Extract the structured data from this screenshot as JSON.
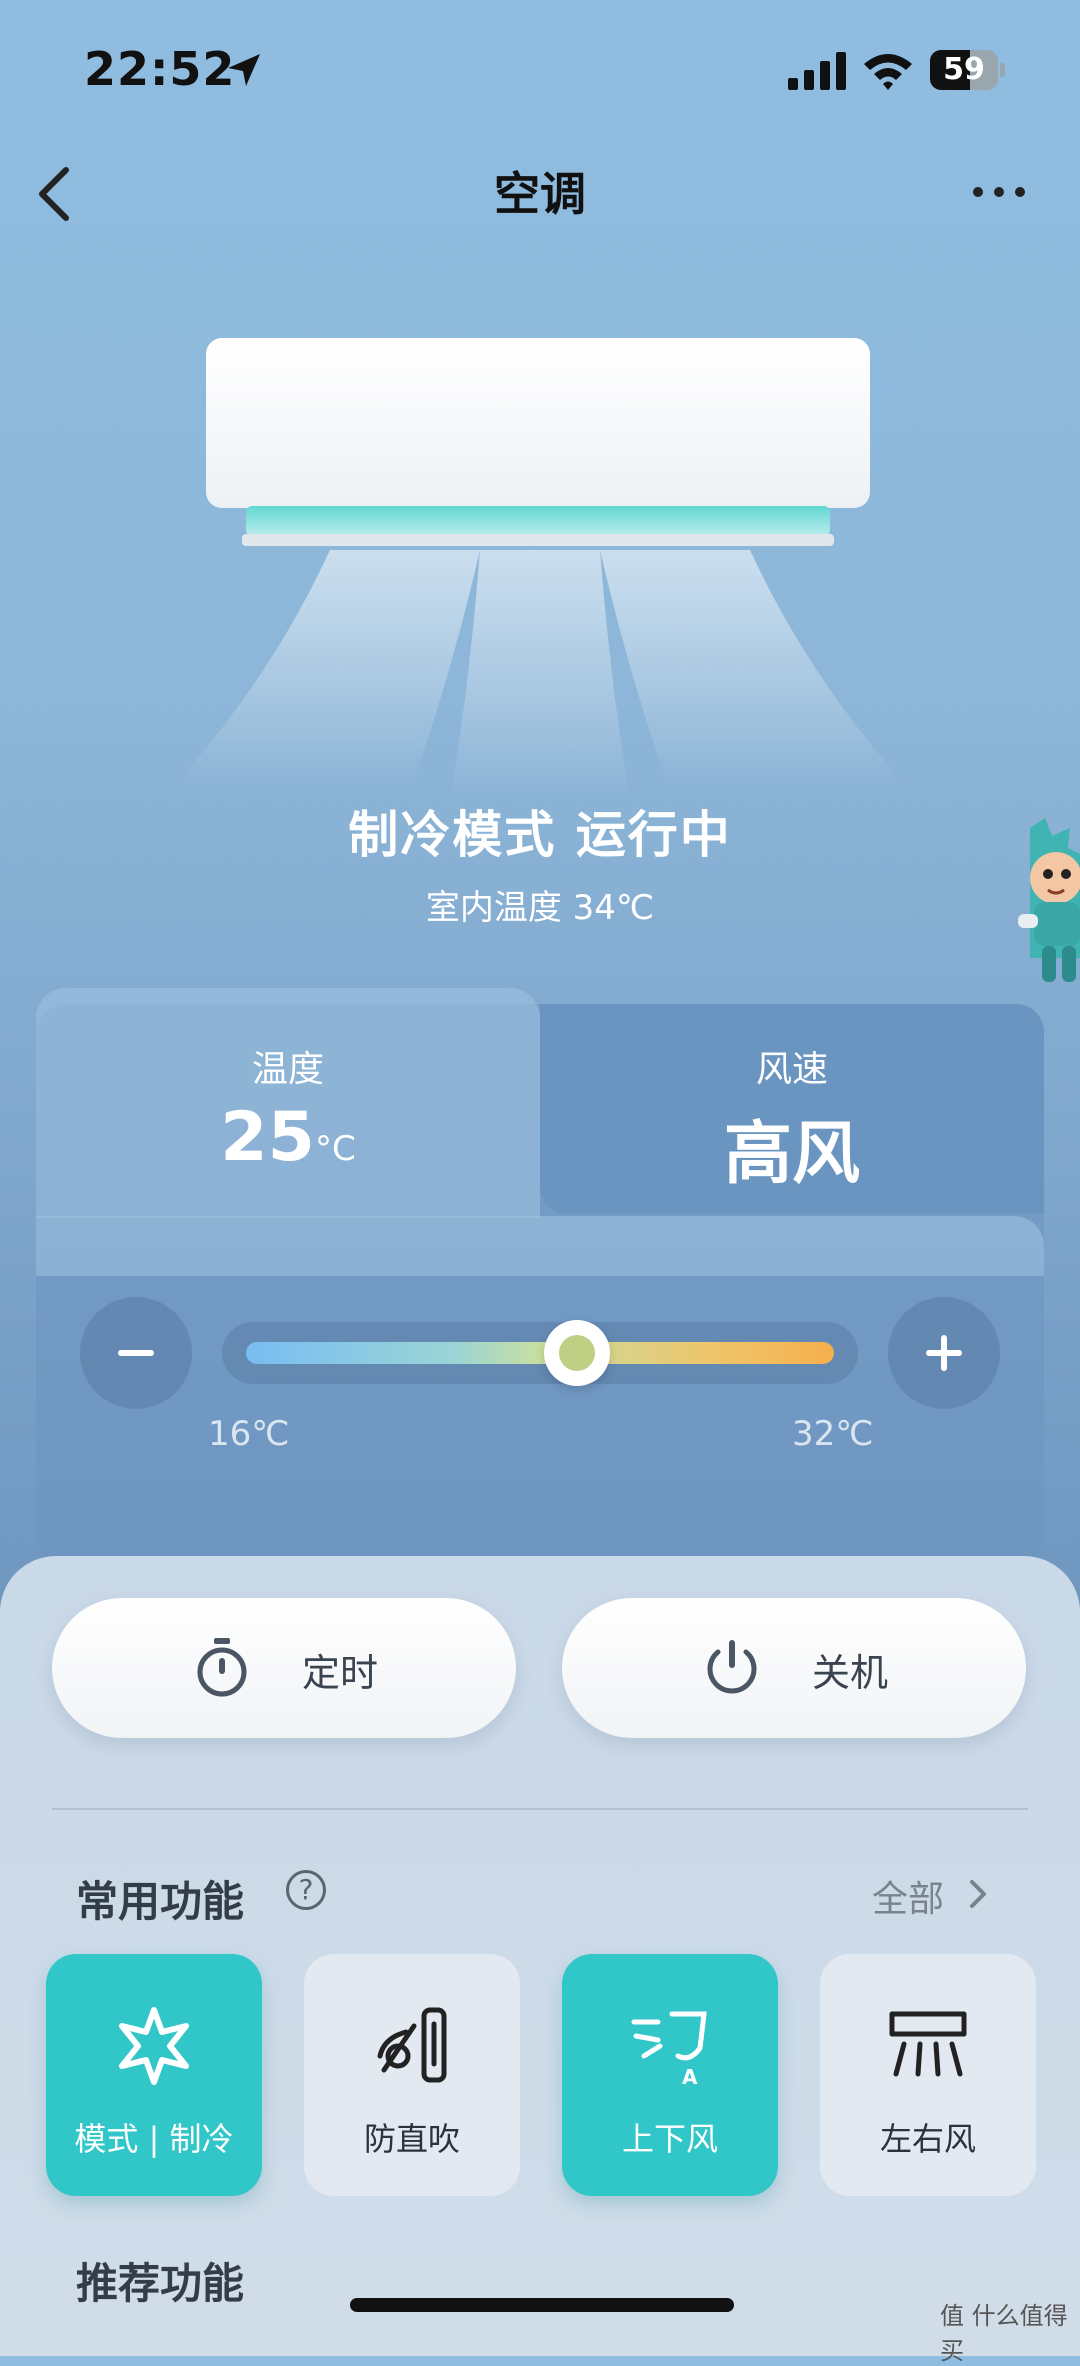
{
  "status_bar": {
    "time": "22:52",
    "battery": "59"
  },
  "nav": {
    "title": "空调"
  },
  "device": {
    "mode_status": "制冷模式 运行中",
    "indoor_temp": "室内温度   34℃"
  },
  "tabs": [
    {
      "label": "温度",
      "value": "25",
      "unit": "°C"
    },
    {
      "label": "风速",
      "value": "高风"
    }
  ],
  "slider": {
    "min_label": "16℃",
    "max_label": "32℃",
    "min": 16,
    "max": 32,
    "value": 25
  },
  "actions": {
    "timer_label": "定时",
    "power_label": "关机"
  },
  "common_functions": {
    "title": "常用功能",
    "all_label": "全部",
    "items": [
      {
        "label": "模式 | 制冷",
        "icon": "snowflake-icon",
        "active": true
      },
      {
        "label": "防直吹",
        "icon": "anti-direct-blow-icon",
        "active": false
      },
      {
        "label": "上下风",
        "icon": "vertical-swing-icon",
        "active": true
      },
      {
        "label": "左右风",
        "icon": "horizontal-swing-icon",
        "active": false
      }
    ]
  },
  "recommended": {
    "title": "推荐功能"
  },
  "watermark": "值 什么值得买",
  "colors": {
    "accent": "#31c6c8",
    "background": "#8fbde0",
    "tab_active": "#6b95c1"
  }
}
